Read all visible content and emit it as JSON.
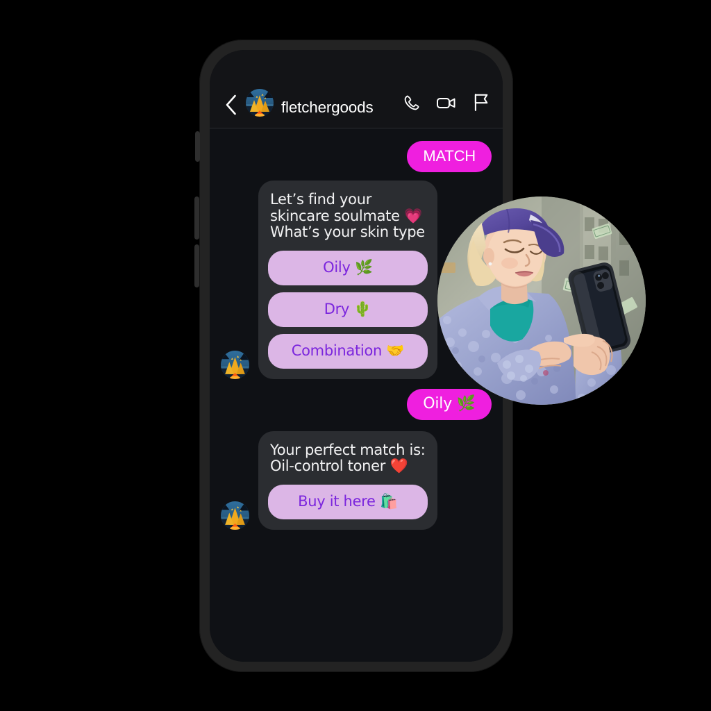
{
  "header": {
    "back_icon": "chevron-left-icon",
    "avatar_alt": "campfire-avatar",
    "username": "fletchergoods",
    "icons": [
      {
        "name": "phone-call-icon",
        "label": "Call"
      },
      {
        "name": "video-camera-icon",
        "label": "Video call"
      },
      {
        "name": "flag-icon",
        "label": "Report"
      }
    ]
  },
  "conversation": [
    {
      "id": "msg-match",
      "direction": "outgoing",
      "text": "MATCH"
    },
    {
      "id": "msg-skin-question",
      "direction": "incoming",
      "text": "Let’s find your skincare soulmate 💗What’s your skin type",
      "quick_replies": [
        {
          "id": "qr-oily",
          "label": "Oily 🌿"
        },
        {
          "id": "qr-dry",
          "label": "Dry 🌵"
        },
        {
          "id": "qr-combination",
          "label": "Combination 🤝"
        }
      ]
    },
    {
      "id": "msg-oily-reply",
      "direction": "outgoing",
      "text": "Oily 🌿"
    },
    {
      "id": "msg-result",
      "direction": "incoming",
      "text": "Your perfect match is: Oil-control toner ❤️",
      "quick_replies": [
        {
          "id": "qr-buy",
          "label": "Buy it here 🛍️"
        }
      ]
    }
  ],
  "photo": {
    "name": "woman-using-phone-photo",
    "description": "Blonde woman in purple visor cap and lavender sherpa fleece jacket tapping a black smartphone on a city street"
  },
  "colors": {
    "accent_magenta": "#ef1fdf",
    "quick_reply_bg": "#dcb6e6",
    "quick_reply_text": "#7b25dd",
    "bubble_in_bg": "#2b2d31",
    "screen_bg": "#0f1115",
    "header_bg": "#131417",
    "frame": "#232323"
  }
}
